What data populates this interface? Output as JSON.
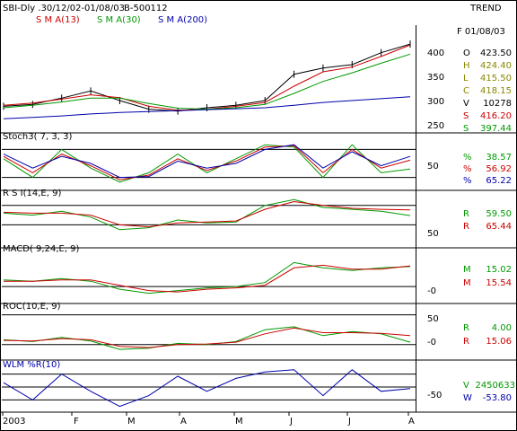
{
  "header": {
    "symbol": "SBI-Dly .30/12/02-01/08/03",
    "code": "B-500112",
    "trend": "TREND",
    "sma_labels": [
      {
        "text": "S M A(13)",
        "color": "#cc0000"
      },
      {
        "text": "S M A(30)",
        "color": "#009900"
      },
      {
        "text": "S M A(200)",
        "color": "#0000aa"
      }
    ]
  },
  "price_panel": {
    "date_label": "F 01/08/03",
    "quotes": [
      {
        "key": "O",
        "value": "423.50",
        "color": "#000000"
      },
      {
        "key": "H",
        "value": "424.40",
        "color": "#888800"
      },
      {
        "key": "L",
        "value": "415.50",
        "color": "#888800"
      },
      {
        "key": "C",
        "value": "418.15",
        "color": "#888800"
      },
      {
        "key": "V",
        "value": "10278",
        "color": "#000000"
      },
      {
        "key": "S",
        "value": "416.20",
        "color": "#cc0000"
      },
      {
        "key": "S",
        "value": "397.44",
        "color": "#009900"
      }
    ],
    "y_ticks": [
      "400",
      "350",
      "300",
      "250"
    ]
  },
  "stoch_panel": {
    "title": "Stoch3( 7, 3, 3)",
    "tick": "50",
    "values": [
      {
        "key": "%",
        "value": "38.57",
        "color": "#009900"
      },
      {
        "key": "%",
        "value": "56.92",
        "color": "#cc0000"
      },
      {
        "key": "%",
        "value": "65.22",
        "color": "#0000aa"
      }
    ]
  },
  "rsi_panel": {
    "title": "R S I(14,E, 9)",
    "tick": "50",
    "values": [
      {
        "key": "R",
        "value": "59.50",
        "color": "#009900"
      },
      {
        "key": "R",
        "value": "65.44",
        "color": "#cc0000"
      }
    ]
  },
  "macd_panel": {
    "title": "MACD( 9,24,E, 9)",
    "tick": "-0",
    "values": [
      {
        "key": "M",
        "value": "15.02",
        "color": "#009900"
      },
      {
        "key": "M",
        "value": "15.54",
        "color": "#cc0000"
      }
    ]
  },
  "roc_panel": {
    "title": "ROC(10,E, 9)",
    "ticks": [
      "50",
      "-0"
    ],
    "values": [
      {
        "key": "R",
        "value": "4.00",
        "color": "#009900"
      },
      {
        "key": "R",
        "value": "15.06",
        "color": "#cc0000"
      }
    ]
  },
  "wlm_panel": {
    "title": "WLM %R(10)",
    "tick": "-50",
    "values": [
      {
        "key": "V",
        "value": "2450633",
        "color": "#009900"
      },
      {
        "key": "W",
        "value": "-53.80",
        "color": "#0000aa"
      }
    ]
  },
  "x_axis": {
    "labels": [
      "2003",
      "F",
      "M",
      "A",
      "M",
      "J",
      "J",
      "A"
    ]
  },
  "chart_data": [
    {
      "type": "line",
      "panel": "price",
      "ylim": [
        240,
        450
      ],
      "x": [
        "2003-01-01",
        "2003-01-15",
        "2003-02-01",
        "2003-02-15",
        "2003-03-01",
        "2003-03-15",
        "2003-04-01",
        "2003-04-15",
        "2003-05-01",
        "2003-05-15",
        "2003-06-01",
        "2003-06-15",
        "2003-07-01",
        "2003-07-15",
        "2003-08-01"
      ],
      "series": [
        {
          "name": "Close",
          "color": "#000000",
          "values": [
            288,
            292,
            305,
            320,
            300,
            282,
            278,
            285,
            290,
            300,
            355,
            368,
            375,
            400,
            418
          ]
        },
        {
          "name": "S M A(13)",
          "color": "#cc0000",
          "values": [
            290,
            295,
            303,
            312,
            306,
            288,
            280,
            282,
            288,
            296,
            330,
            360,
            370,
            392,
            416
          ]
        },
        {
          "name": "S M A(30)",
          "color": "#009900",
          "values": [
            285,
            290,
            297,
            305,
            305,
            294,
            284,
            282,
            285,
            292,
            315,
            340,
            358,
            378,
            397
          ]
        },
        {
          "name": "S M A(200)",
          "color": "#0000aa",
          "values": [
            262,
            265,
            268,
            272,
            275,
            277,
            279,
            281,
            283,
            285,
            290,
            296,
            300,
            304,
            308
          ]
        }
      ]
    },
    {
      "type": "line",
      "panel": "stoch",
      "ylim": [
        0,
        100
      ],
      "hlines": [
        20,
        80
      ],
      "x": [
        "2003-01-01",
        "2003-01-15",
        "2003-02-01",
        "2003-02-15",
        "2003-03-01",
        "2003-03-15",
        "2003-04-01",
        "2003-04-15",
        "2003-05-01",
        "2003-05-15",
        "2003-06-01",
        "2003-06-15",
        "2003-07-01",
        "2003-07-15",
        "2003-08-01"
      ],
      "series": [
        {
          "color": "#009900",
          "values": [
            60,
            20,
            80,
            40,
            10,
            30,
            70,
            30,
            60,
            90,
            85,
            20,
            90,
            30,
            38
          ]
        },
        {
          "color": "#cc0000",
          "values": [
            65,
            30,
            70,
            45,
            15,
            25,
            60,
            35,
            55,
            85,
            88,
            30,
            80,
            40,
            57
          ]
        },
        {
          "color": "#0000aa",
          "values": [
            70,
            40,
            65,
            50,
            20,
            22,
            55,
            40,
            50,
            80,
            90,
            40,
            75,
            45,
            65
          ]
        }
      ]
    },
    {
      "type": "line",
      "panel": "rsi",
      "ylim": [
        30,
        80
      ],
      "hlines": [
        70,
        50
      ],
      "x": [
        "2003-01-01",
        "2003-01-15",
        "2003-02-01",
        "2003-02-15",
        "2003-03-01",
        "2003-03-15",
        "2003-04-01",
        "2003-04-15",
        "2003-05-01",
        "2003-05-15",
        "2003-06-01",
        "2003-06-15",
        "2003-07-01",
        "2003-07-15",
        "2003-08-01"
      ],
      "series": [
        {
          "color": "#009900",
          "values": [
            62,
            60,
            64,
            58,
            45,
            47,
            55,
            52,
            53,
            70,
            76,
            68,
            66,
            64,
            59.5
          ]
        },
        {
          "color": "#cc0000",
          "values": [
            63,
            62,
            62,
            60,
            50,
            48,
            52,
            53,
            54,
            66,
            74,
            70,
            67,
            66,
            65.4
          ]
        }
      ]
    },
    {
      "type": "line",
      "panel": "macd",
      "ylim": [
        -10,
        25
      ],
      "hlines": [
        0
      ],
      "x": [
        "2003-01-01",
        "2003-01-15",
        "2003-02-01",
        "2003-02-15",
        "2003-03-01",
        "2003-03-15",
        "2003-04-01",
        "2003-04-15",
        "2003-05-01",
        "2003-05-15",
        "2003-06-01",
        "2003-06-15",
        "2003-07-01",
        "2003-07-15",
        "2003-08-01"
      ],
      "series": [
        {
          "color": "#009900",
          "values": [
            5,
            4,
            6,
            4,
            -2,
            -5,
            -3,
            -1,
            0,
            3,
            18,
            14,
            12,
            14,
            15
          ]
        },
        {
          "color": "#cc0000",
          "values": [
            4,
            4,
            5,
            5,
            1,
            -3,
            -4,
            -2,
            -1,
            1,
            14,
            16,
            13,
            13,
            15.5
          ]
        }
      ]
    },
    {
      "type": "line",
      "panel": "roc",
      "ylim": [
        -20,
        60
      ],
      "hlines": [
        50,
        0
      ],
      "x": [
        "2003-01-01",
        "2003-01-15",
        "2003-02-01",
        "2003-02-15",
        "2003-03-01",
        "2003-03-15",
        "2003-04-01",
        "2003-04-15",
        "2003-05-01",
        "2003-05-15",
        "2003-06-01",
        "2003-06-15",
        "2003-07-01",
        "2003-07-15",
        "2003-08-01"
      ],
      "series": [
        {
          "color": "#009900",
          "values": [
            8,
            5,
            12,
            6,
            -8,
            -6,
            2,
            0,
            5,
            25,
            30,
            15,
            22,
            18,
            4
          ]
        },
        {
          "color": "#cc0000",
          "values": [
            7,
            6,
            10,
            8,
            -3,
            -5,
            0,
            1,
            4,
            18,
            28,
            20,
            20,
            19,
            15
          ]
        }
      ]
    },
    {
      "type": "line",
      "panel": "wlm",
      "ylim": [
        -100,
        0
      ],
      "hlines": [
        -20,
        -50,
        -80
      ],
      "x": [
        "2003-01-01",
        "2003-01-15",
        "2003-02-01",
        "2003-02-15",
        "2003-03-01",
        "2003-03-15",
        "2003-04-01",
        "2003-04-15",
        "2003-05-01",
        "2003-05-15",
        "2003-06-01",
        "2003-06-15",
        "2003-07-01",
        "2003-07-15",
        "2003-08-01"
      ],
      "series": [
        {
          "color": "#0000aa",
          "values": [
            -40,
            -80,
            -20,
            -60,
            -95,
            -70,
            -25,
            -60,
            -30,
            -15,
            -10,
            -70,
            -10,
            -60,
            -53.8
          ]
        }
      ]
    }
  ]
}
